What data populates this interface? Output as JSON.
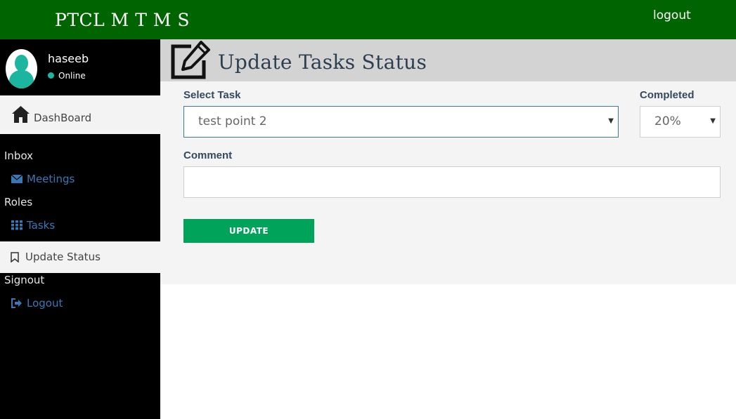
{
  "header": {
    "brand": "PTCL M T M S",
    "logout_label": "logout"
  },
  "user": {
    "name": "haseeb",
    "status": "Online"
  },
  "sidebar": {
    "dashboard_label": "DashBoard",
    "inbox_heading": "Inbox",
    "meetings_label": "Meetings",
    "roles_heading": "Roles",
    "tasks_label": "Tasks",
    "update_status_label": "Update Status",
    "signout_heading": "Signout",
    "logout_label": "Logout"
  },
  "page": {
    "title": "Update Tasks Status"
  },
  "form": {
    "task_label": "Select Task",
    "task_value": "test point 2",
    "completed_label": "Completed",
    "completed_value": "20%",
    "comment_label": "Comment",
    "comment_value": "",
    "update_button": "UPDATE"
  },
  "colors": {
    "topbar": "#006400",
    "sidebar": "#000000",
    "accent_link": "#3a78b5",
    "update_button": "#00a35a",
    "online_dot": "#1cb5a0"
  }
}
